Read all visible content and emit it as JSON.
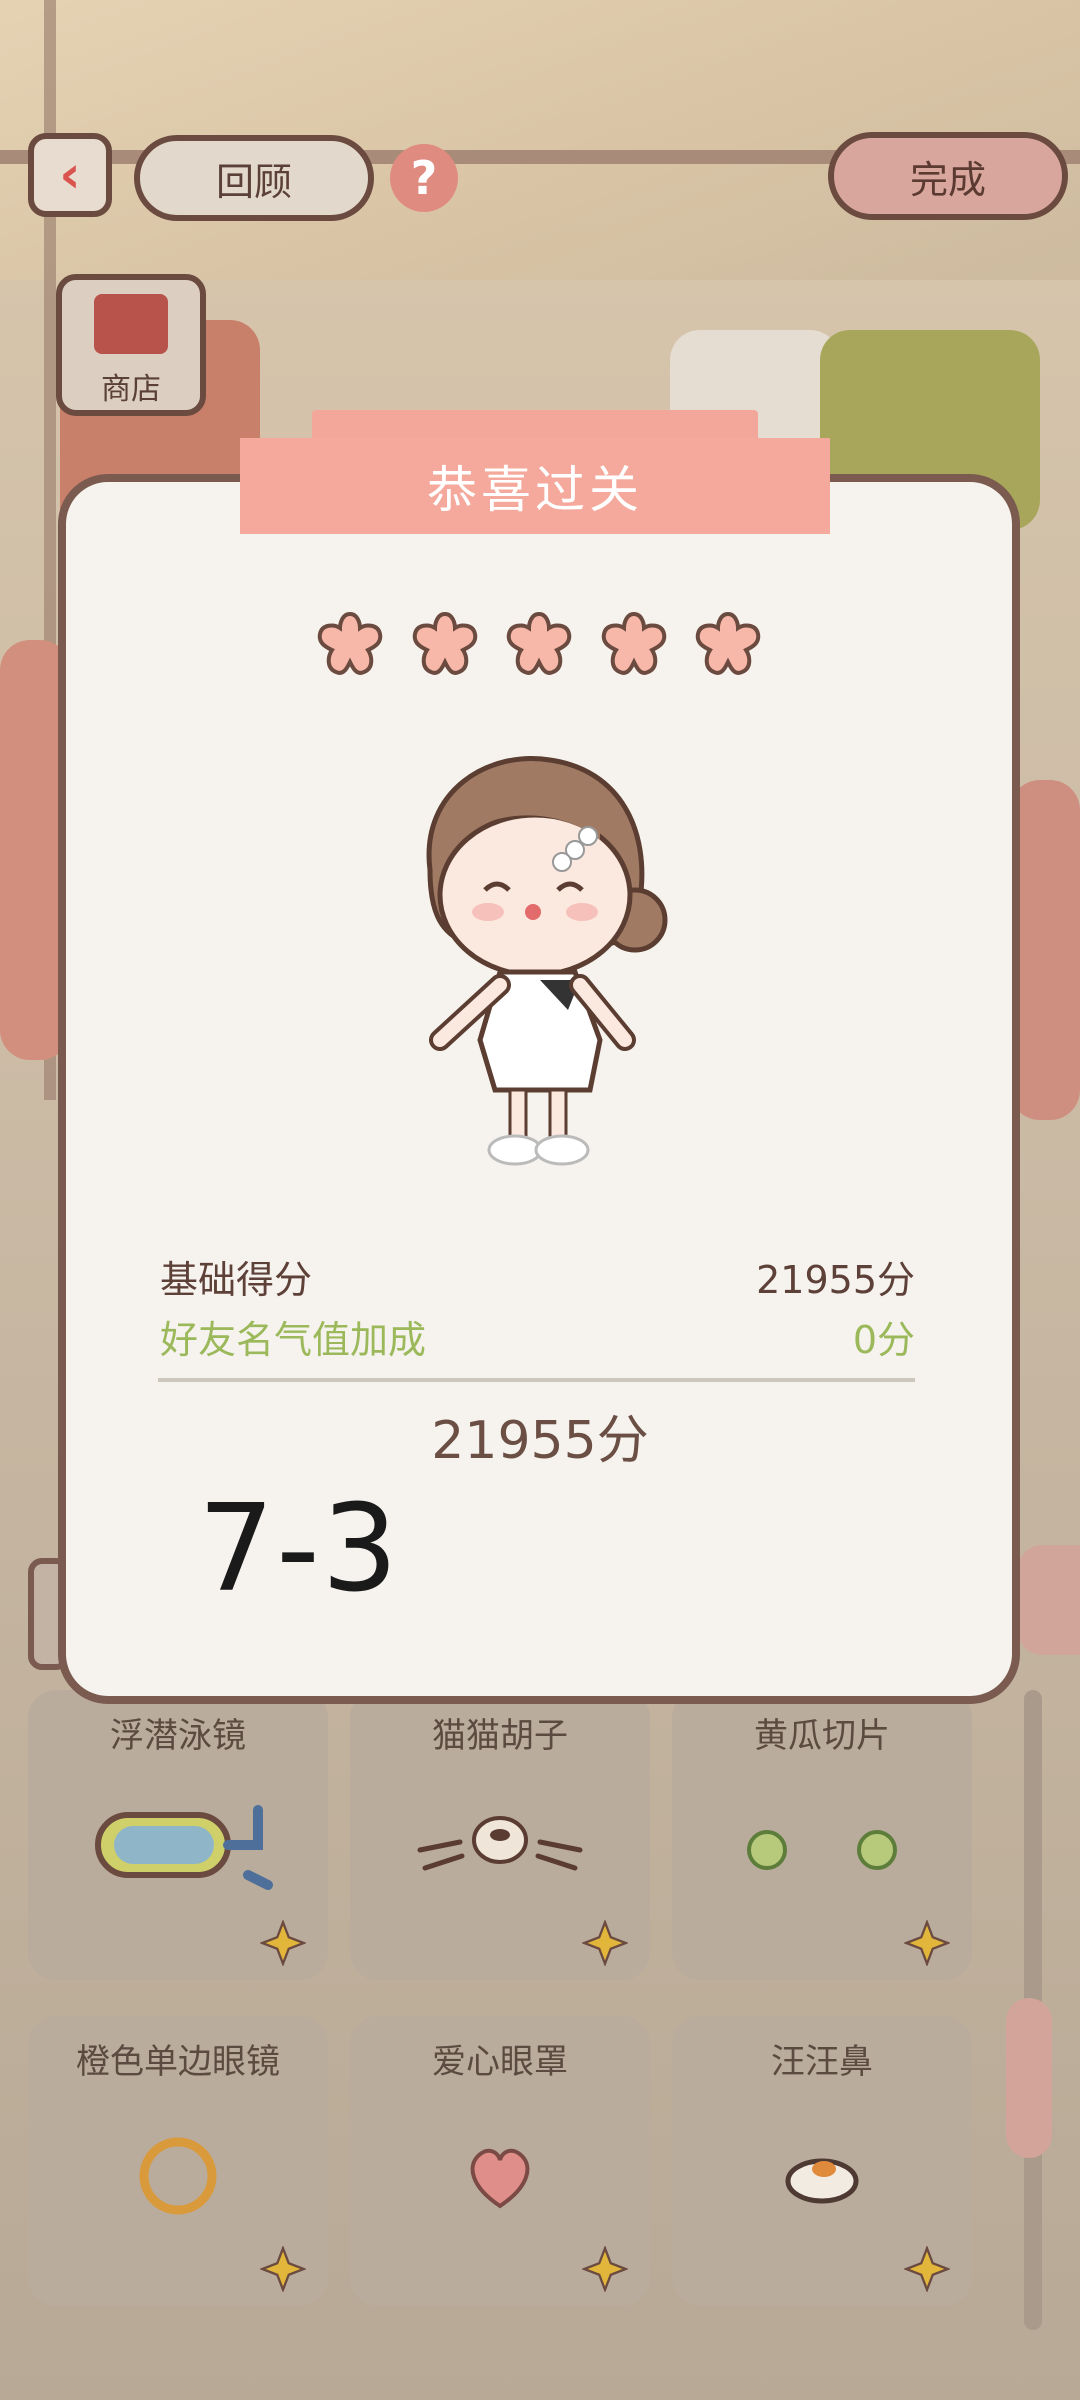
{
  "header": {
    "back_icon": "chevron-left-icon",
    "review_label": "回顾",
    "help_icon": "question-icon",
    "help_glyph": "?",
    "done_label": "完成"
  },
  "shop": {
    "label": "商店",
    "icon": "shop-icon"
  },
  "result": {
    "ribbon_title": "恭喜过关",
    "stars_earned": 5,
    "stars_total": 5,
    "base_score_label": "基础得分",
    "base_score_value": "21955分",
    "bonus_label": "好友名气值加成",
    "bonus_value": "0分",
    "total_score": "21955分",
    "handwritten_note": "7-3"
  },
  "items": [
    {
      "label": "浮潜泳镜",
      "icon": "snorkel-goggles-icon"
    },
    {
      "label": "猫猫胡子",
      "icon": "cat-whiskers-icon"
    },
    {
      "label": "黄瓜切片",
      "icon": "cucumber-slices-icon"
    },
    {
      "label": "橙色单边眼镜",
      "icon": "monocle-icon"
    },
    {
      "label": "爱心眼罩",
      "icon": "heart-eyepatch-icon"
    },
    {
      "label": "汪汪鼻",
      "icon": "dog-nose-icon"
    }
  ],
  "colors": {
    "accent": "#f5a99c",
    "border": "#7b5a4f",
    "bonus_text": "#9bb95b",
    "popup_bg": "#f6f3ee"
  }
}
